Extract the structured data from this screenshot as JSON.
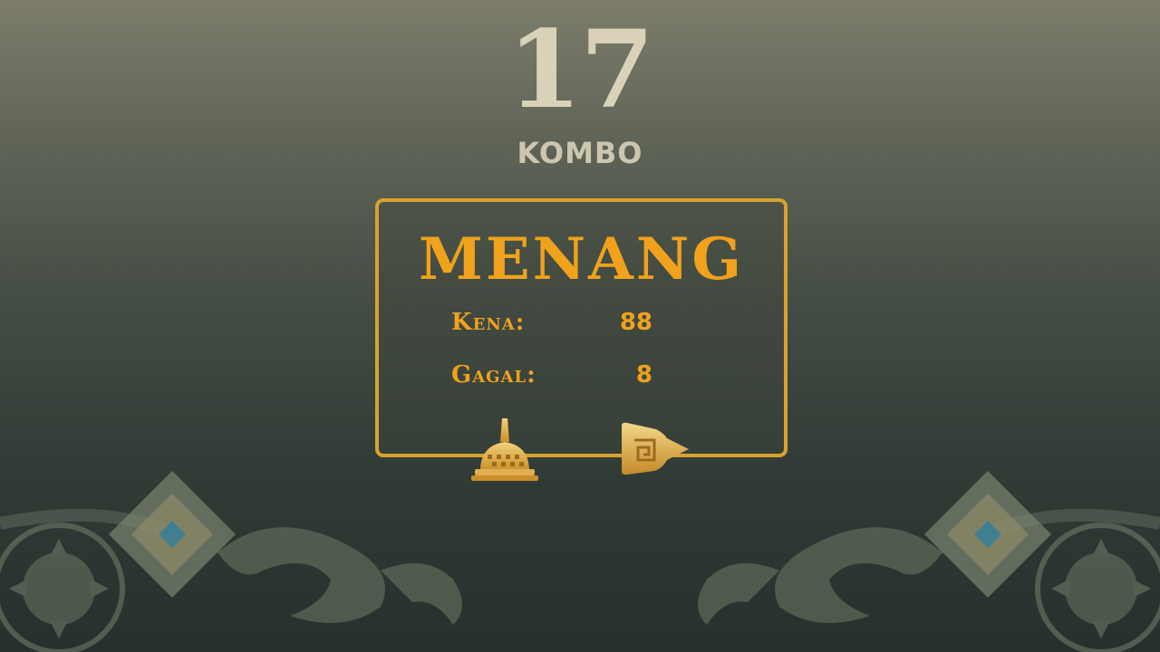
{
  "combo": {
    "count": "17",
    "label": "KOMBO"
  },
  "result": {
    "title": "MENANG",
    "stats": [
      {
        "label": "Kena:",
        "value": "88"
      },
      {
        "label": "Gagal:",
        "value": "8"
      }
    ]
  },
  "buttons": {
    "home_icon": "stupa-icon",
    "next_icon": "next-arrow-icon"
  },
  "colors": {
    "accent": "#f0a21c",
    "panel_border": "#d8a22e",
    "combo_text": "#d9d2b8"
  }
}
